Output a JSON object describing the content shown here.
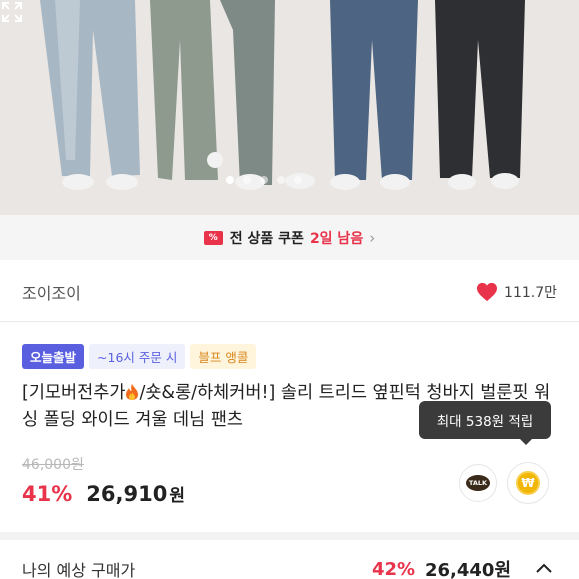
{
  "coupon": {
    "icon": "coupon-ticket-icon",
    "text": "전 상품 쿠폰",
    "days_left": "2일 남음",
    "chevron": "›"
  },
  "seller": {
    "name": "조이조이",
    "likes": "111.7만",
    "heart_color": "#e8334a"
  },
  "badges": [
    {
      "label": "오늘출발"
    },
    {
      "label": "~16시 주문 시"
    },
    {
      "label": "블프 앵콜"
    }
  ],
  "product": {
    "title_part1": "[기모버전추가",
    "title_part2": "/숏&롱/하체커버!] 솔리 트리드 옆핀턱 청바지 벌룬핏 워싱 폴딩 와이드 겨울 데님 팬츠"
  },
  "tooltip": "최대 538원 적립",
  "price": {
    "original": "46,000원",
    "discount": "41%",
    "amount": "26,910",
    "unit": "원"
  },
  "share": {
    "talk_label": "TALK",
    "pay_label": "₩"
  },
  "expected": {
    "label": "나의 예상 구매가",
    "discount": "42%",
    "amount": "26,440원"
  },
  "colors": {
    "accent": "#e8334a",
    "badge_blue": "#5a5fe0",
    "badge_orange": "#d7861c"
  }
}
